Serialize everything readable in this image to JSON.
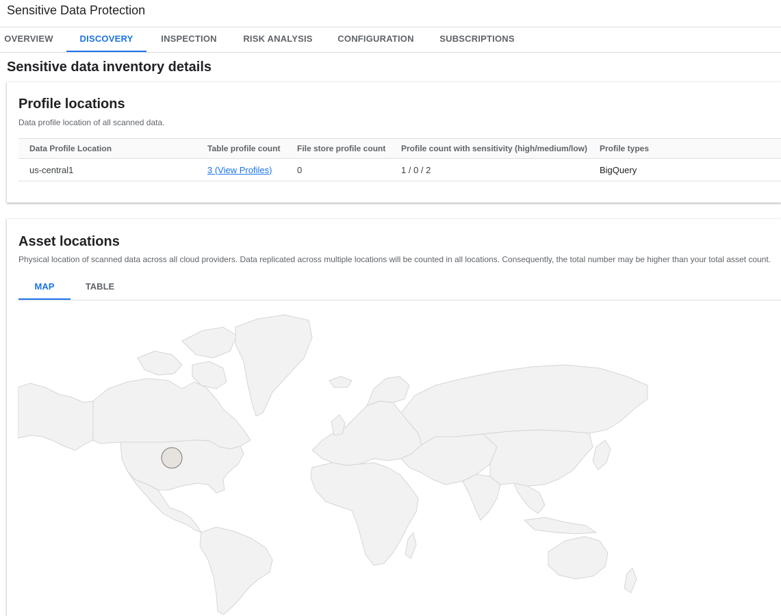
{
  "app": {
    "title": "Sensitive Data Protection"
  },
  "nav": {
    "tabs": [
      {
        "label": "OVERVIEW"
      },
      {
        "label": "DISCOVERY"
      },
      {
        "label": "INSPECTION"
      },
      {
        "label": "RISK ANALYSIS"
      },
      {
        "label": "CONFIGURATION"
      },
      {
        "label": "SUBSCRIPTIONS"
      }
    ],
    "active": "DISCOVERY"
  },
  "page": {
    "heading": "Sensitive data inventory details"
  },
  "profile_locations": {
    "title": "Profile locations",
    "description": "Data profile location of all scanned data.",
    "columns": [
      "Data Profile Location",
      "Table profile count",
      "File store profile count",
      "Profile count with sensitivity (high/medium/low)",
      "Profile types"
    ],
    "rows": [
      {
        "location": "us-central1",
        "table_profile_count": "3 (View Profiles)",
        "file_store_profile_count": "0",
        "sensitivity": "1 / 0 / 2",
        "profile_types": "BigQuery"
      }
    ]
  },
  "asset_locations": {
    "title": "Asset locations",
    "description": "Physical location of scanned data across all cloud providers. Data replicated across multiple locations will be counted in all locations. Consequently, the total number may be higher than your total asset count.",
    "tabs": [
      {
        "label": "MAP"
      },
      {
        "label": "TABLE"
      }
    ],
    "active_tab": "MAP",
    "marker": {
      "region": "us-central1"
    }
  },
  "colors": {
    "accent": "#1a73e8",
    "land": "#f2f2f2",
    "border": "#d5d5d5",
    "marker": "#e6e2de"
  }
}
